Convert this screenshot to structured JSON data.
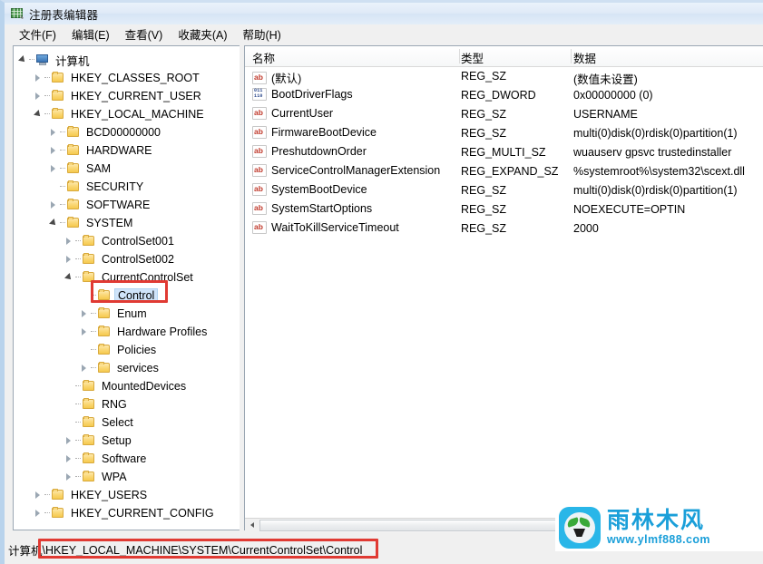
{
  "window": {
    "title": "注册表编辑器",
    "icon": "registry-editor-icon"
  },
  "menubar": {
    "items": [
      {
        "label": "文件(F)",
        "name": "menu-file"
      },
      {
        "label": "编辑(E)",
        "name": "menu-edit"
      },
      {
        "label": "查看(V)",
        "name": "menu-view"
      },
      {
        "label": "收藏夹(A)",
        "name": "menu-favorites"
      },
      {
        "label": "帮助(H)",
        "name": "menu-help"
      }
    ]
  },
  "tree": {
    "nodes": [
      {
        "label": "计算机",
        "depth": 0,
        "state": "expanded",
        "icon": "computer-icon",
        "selected": false
      },
      {
        "label": "HKEY_CLASSES_ROOT",
        "depth": 1,
        "state": "collapsed",
        "icon": "folder-icon",
        "selected": false
      },
      {
        "label": "HKEY_CURRENT_USER",
        "depth": 1,
        "state": "collapsed",
        "icon": "folder-icon",
        "selected": false
      },
      {
        "label": "HKEY_LOCAL_MACHINE",
        "depth": 1,
        "state": "expanded",
        "icon": "folder-icon",
        "selected": false
      },
      {
        "label": "BCD00000000",
        "depth": 2,
        "state": "collapsed",
        "icon": "folder-icon",
        "selected": false
      },
      {
        "label": "HARDWARE",
        "depth": 2,
        "state": "collapsed",
        "icon": "folder-icon",
        "selected": false
      },
      {
        "label": "SAM",
        "depth": 2,
        "state": "collapsed",
        "icon": "folder-icon",
        "selected": false
      },
      {
        "label": "SECURITY",
        "depth": 2,
        "state": "leaf",
        "icon": "folder-icon",
        "selected": false
      },
      {
        "label": "SOFTWARE",
        "depth": 2,
        "state": "collapsed",
        "icon": "folder-icon",
        "selected": false
      },
      {
        "label": "SYSTEM",
        "depth": 2,
        "state": "expanded",
        "icon": "folder-icon",
        "selected": false
      },
      {
        "label": "ControlSet001",
        "depth": 3,
        "state": "collapsed",
        "icon": "folder-icon",
        "selected": false
      },
      {
        "label": "ControlSet002",
        "depth": 3,
        "state": "collapsed",
        "icon": "folder-icon",
        "selected": false
      },
      {
        "label": "CurrentControlSet",
        "depth": 3,
        "state": "expanded",
        "icon": "folder-icon",
        "selected": false
      },
      {
        "label": "Control",
        "depth": 4,
        "state": "leaf",
        "icon": "folder-icon",
        "selected": true
      },
      {
        "label": "Enum",
        "depth": 4,
        "state": "collapsed",
        "icon": "folder-icon",
        "selected": false
      },
      {
        "label": "Hardware Profiles",
        "depth": 4,
        "state": "collapsed",
        "icon": "folder-icon",
        "selected": false
      },
      {
        "label": "Policies",
        "depth": 4,
        "state": "leaf",
        "icon": "folder-icon",
        "selected": false
      },
      {
        "label": "services",
        "depth": 4,
        "state": "collapsed",
        "icon": "folder-icon",
        "selected": false
      },
      {
        "label": "MountedDevices",
        "depth": 3,
        "state": "leaf",
        "icon": "folder-icon",
        "selected": false
      },
      {
        "label": "RNG",
        "depth": 3,
        "state": "leaf",
        "icon": "folder-icon",
        "selected": false
      },
      {
        "label": "Select",
        "depth": 3,
        "state": "leaf",
        "icon": "folder-icon",
        "selected": false
      },
      {
        "label": "Setup",
        "depth": 3,
        "state": "collapsed",
        "icon": "folder-icon",
        "selected": false
      },
      {
        "label": "Software",
        "depth": 3,
        "state": "collapsed",
        "icon": "folder-icon",
        "selected": false
      },
      {
        "label": "WPA",
        "depth": 3,
        "state": "collapsed",
        "icon": "folder-icon",
        "selected": false
      },
      {
        "label": "HKEY_USERS",
        "depth": 1,
        "state": "collapsed",
        "icon": "folder-icon",
        "selected": false
      },
      {
        "label": "HKEY_CURRENT_CONFIG",
        "depth": 1,
        "state": "collapsed",
        "icon": "folder-icon",
        "selected": false
      }
    ]
  },
  "list": {
    "columns": [
      {
        "label": "名称",
        "name": "column-name"
      },
      {
        "label": "类型",
        "name": "column-type"
      },
      {
        "label": "数据",
        "name": "column-data"
      }
    ],
    "rows": [
      {
        "name": "(默认)",
        "type": "REG_SZ",
        "data": "(数值未设置)",
        "icon": "string-value-icon"
      },
      {
        "name": "BootDriverFlags",
        "type": "REG_DWORD",
        "data": "0x00000000 (0)",
        "icon": "dword-value-icon"
      },
      {
        "name": "CurrentUser",
        "type": "REG_SZ",
        "data": "USERNAME",
        "icon": "string-value-icon"
      },
      {
        "name": "FirmwareBootDevice",
        "type": "REG_SZ",
        "data": "multi(0)disk(0)rdisk(0)partition(1)",
        "icon": "string-value-icon"
      },
      {
        "name": "PreshutdownOrder",
        "type": "REG_MULTI_SZ",
        "data": "wuauserv gpsvc trustedinstaller",
        "icon": "string-value-icon"
      },
      {
        "name": "ServiceControlManagerExtension",
        "type": "REG_EXPAND_SZ",
        "data": "%systemroot%\\system32\\scext.dll",
        "icon": "string-value-icon"
      },
      {
        "name": "SystemBootDevice",
        "type": "REG_SZ",
        "data": "multi(0)disk(0)rdisk(0)partition(1)",
        "icon": "string-value-icon"
      },
      {
        "name": "SystemStartOptions",
        "type": "REG_SZ",
        "data": " NOEXECUTE=OPTIN",
        "icon": "string-value-icon"
      },
      {
        "name": "WaitToKillServiceTimeout",
        "type": "REG_SZ",
        "data": "2000",
        "icon": "string-value-icon"
      }
    ]
  },
  "statusbar": {
    "prefix": "计算机",
    "path": "\\HKEY_LOCAL_MACHINE\\SYSTEM\\CurrentControlSet\\Control"
  },
  "scrollbar": {
    "left_arrow": "scroll-left-icon",
    "right_arrow": "scroll-right-icon"
  },
  "watermark": {
    "title": "雨林木风",
    "url": "www.ylmf888.com"
  },
  "colors": {
    "annotation": "#e03a33",
    "selection": "#cfe4fa",
    "brand": "#1a9fd9",
    "titlebar": "#d6e4f5"
  }
}
